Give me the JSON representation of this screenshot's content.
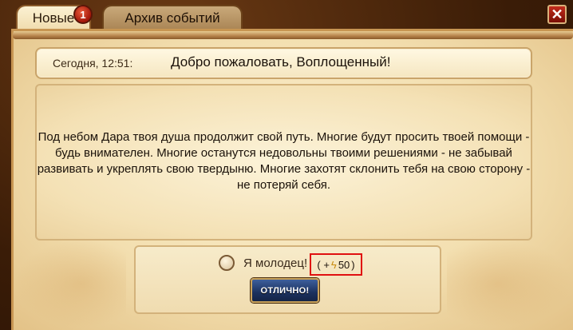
{
  "tabs": {
    "new_label": "Новые",
    "new_badge": "1",
    "archive_label": "Архив событий"
  },
  "close_label": "✕",
  "message": {
    "date": "Сегодня, 12:51:",
    "title": "Добро пожаловать, Воплощенный!",
    "body": "Под небом Дара твоя душа продолжит свой путь. Многие будут просить твоей помощи - будь внимателен. Многие останутся недовольны твоими решениями - не забывай развивать и укреплять свою твердыню. Многие захотят склонить тебя на свою сторону - не потеряй себя."
  },
  "footer": {
    "checkbox_label": "Я молодец!",
    "reward_prefix": "( +",
    "reward_icon": "lightning-icon",
    "reward_value": "50",
    "reward_suffix": ")",
    "ok_button": "ОТЛИЧНО!"
  },
  "colors": {
    "badge": "#b3200f",
    "ok_button": "#1b315e",
    "highlight_border": "#e01010"
  }
}
